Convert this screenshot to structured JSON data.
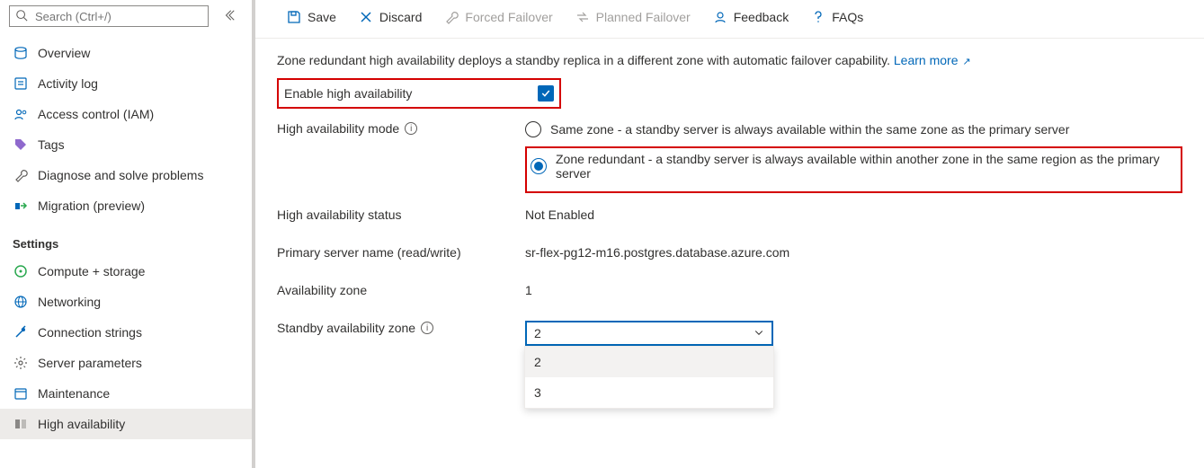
{
  "search": {
    "placeholder": "Search (Ctrl+/)"
  },
  "nav": {
    "items": [
      {
        "label": "Overview"
      },
      {
        "label": "Activity log"
      },
      {
        "label": "Access control (IAM)"
      },
      {
        "label": "Tags"
      },
      {
        "label": "Diagnose and solve problems"
      },
      {
        "label": "Migration (preview)"
      }
    ],
    "settings_heading": "Settings",
    "settings_items": [
      {
        "label": "Compute + storage"
      },
      {
        "label": "Networking"
      },
      {
        "label": "Connection strings"
      },
      {
        "label": "Server parameters"
      },
      {
        "label": "Maintenance"
      },
      {
        "label": "High availability"
      }
    ]
  },
  "toolbar": {
    "save": "Save",
    "discard": "Discard",
    "forced_failover": "Forced Failover",
    "planned_failover": "Planned Failover",
    "feedback": "Feedback",
    "faqs": "FAQs"
  },
  "main": {
    "description": "Zone redundant high availability deploys a standby replica in a different zone with automatic failover capability. ",
    "learn_more": "Learn more",
    "enable_ha_label": "Enable high availability",
    "enable_ha_checked": true,
    "mode_label": "High availability mode",
    "mode_options": {
      "same_zone": "Same zone - a standby server is always available within the same zone as the primary server",
      "zone_redundant": "Zone redundant - a standby server is always available within another zone in the same region as the primary server"
    },
    "mode_selected": "zone_redundant",
    "status_label": "High availability status",
    "status_value": "Not Enabled",
    "primary_label": "Primary server name (read/write)",
    "primary_value": "sr-flex-pg12-m16.postgres.database.azure.com",
    "avail_zone_label": "Availability zone",
    "avail_zone_value": "1",
    "standby_zone_label": "Standby availability zone",
    "standby_zone_value": "2",
    "standby_zone_options": [
      "2",
      "3"
    ]
  }
}
